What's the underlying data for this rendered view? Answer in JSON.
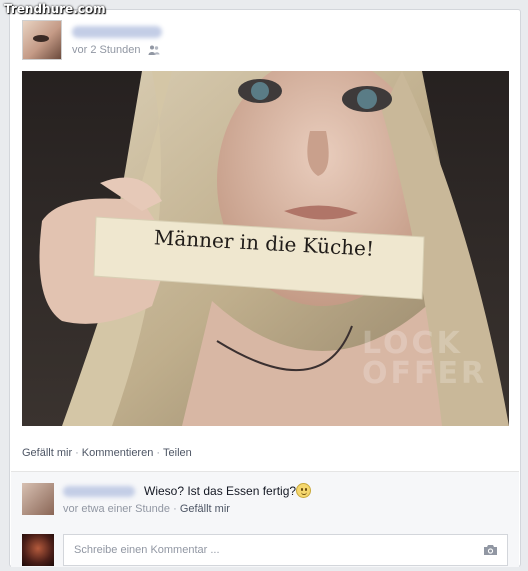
{
  "watermark": "Trendhure.com",
  "post": {
    "time": "vor 2 Stunden",
    "privacy_icon": "friends-icon",
    "photo": {
      "sign_text": "Männer in die Küche!",
      "watermark_lines": [
        "LOCK",
        "OFFER"
      ]
    }
  },
  "actions": {
    "like": "Gefällt mir",
    "comment": "Kommentieren",
    "share": "Teilen",
    "separator": "·"
  },
  "comment": {
    "text": "Wieso? Ist das Essen fertig?",
    "emoji_icon": "smiley-icon",
    "time": "vor etwa einer Stunde",
    "separator": "·",
    "like": "Gefällt mir"
  },
  "write_comment": {
    "placeholder": "Schreibe einen Kommentar ...",
    "camera_icon": "camera-icon"
  },
  "colors": {
    "page_bg": "#e9ebee",
    "card_bg": "#ffffff",
    "meta_text": "#9197a3",
    "link_text": "#4e5665"
  }
}
